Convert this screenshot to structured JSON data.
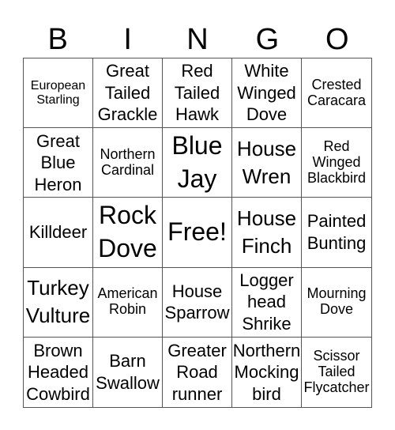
{
  "header": [
    "B",
    "I",
    "N",
    "G",
    "O"
  ],
  "cells": [
    {
      "text": "European Starling",
      "size": "xs"
    },
    {
      "text": "Great Tailed Grackle",
      "size": "md"
    },
    {
      "text": "Red Tailed Hawk",
      "size": "md"
    },
    {
      "text": "White Winged Dove",
      "size": "md"
    },
    {
      "text": "Crested Caracara",
      "size": "sm"
    },
    {
      "text": "Great Blue Heron",
      "size": "md"
    },
    {
      "text": "Northern Cardinal",
      "size": "sm"
    },
    {
      "text": "Blue Jay",
      "size": "xl"
    },
    {
      "text": "House Wren",
      "size": "lg"
    },
    {
      "text": "Red Winged Blackbird",
      "size": "sm"
    },
    {
      "text": "Killdeer",
      "size": "md"
    },
    {
      "text": "Rock Dove",
      "size": "xl"
    },
    {
      "text": "Free!",
      "size": "xl"
    },
    {
      "text": "House Finch",
      "size": "lg"
    },
    {
      "text": "Painted Bunting",
      "size": "md"
    },
    {
      "text": "Turkey Vulture",
      "size": "lg"
    },
    {
      "text": "American Robin",
      "size": "sm"
    },
    {
      "text": "House Sparrow",
      "size": "md"
    },
    {
      "text": "Logger head Shrike",
      "size": "md"
    },
    {
      "text": "Mourning Dove",
      "size": "sm"
    },
    {
      "text": "Brown Headed Cowbird",
      "size": "md"
    },
    {
      "text": "Barn Swallow",
      "size": "md"
    },
    {
      "text": "Greater Road runner",
      "size": "md"
    },
    {
      "text": "Northern Mocking bird",
      "size": "md"
    },
    {
      "text": "Scissor Tailed Flycatcher",
      "size": "sm"
    }
  ]
}
